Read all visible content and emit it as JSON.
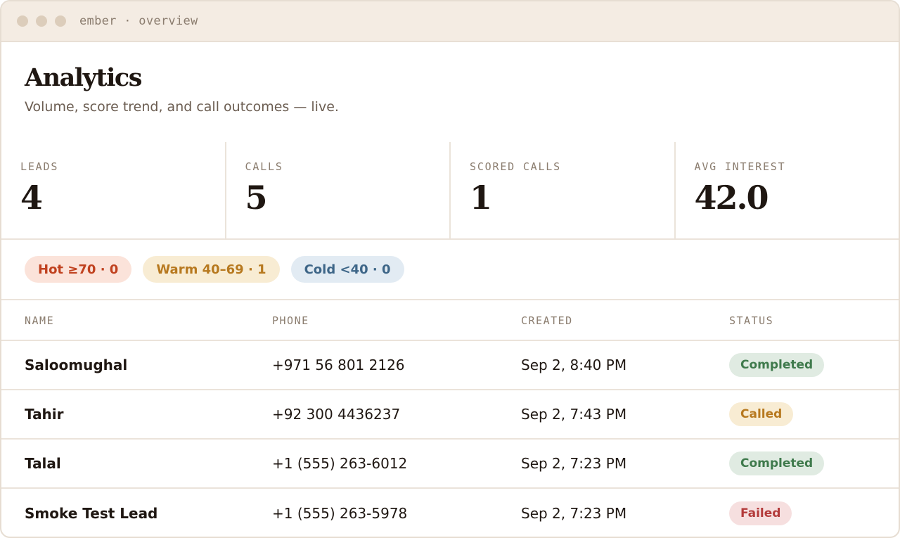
{
  "window": {
    "title": "ember · overview"
  },
  "header": {
    "title": "Analytics",
    "subtitle": "Volume, score trend, and call outcomes — live."
  },
  "stats": [
    {
      "label": "LEADS",
      "value": "4"
    },
    {
      "label": "CALLS",
      "value": "5"
    },
    {
      "label": "SCORED CALLS",
      "value": "1"
    },
    {
      "label": "AVG INTEREST",
      "value": "42.0"
    }
  ],
  "pills": [
    {
      "label": "Hot ≥70 · 0",
      "color": "#c0411f"
    },
    {
      "label": "Warm 40–69 · 1",
      "color": "#b7791f"
    },
    {
      "label": "Cold <40 · 0",
      "color": "#3e6688"
    }
  ],
  "table": {
    "columns": [
      "NAME",
      "PHONE",
      "CREATED",
      "STATUS"
    ],
    "rows": [
      {
        "name": "Saloomughal",
        "phone": "+971 56 801 2126",
        "created": "Sep 2, 8:40 PM",
        "status": "Completed"
      },
      {
        "name": "Tahir",
        "phone": "+92 300 4436237",
        "created": "Sep 2, 7:43 PM",
        "status": "Called"
      },
      {
        "name": "Talal",
        "phone": "+1 (555) 263-6012",
        "created": "Sep 2, 7:23 PM",
        "status": "Completed"
      },
      {
        "name": "Smoke Test Lead",
        "phone": "+1 (555) 263-5978",
        "created": "Sep 2, 7:23 PM",
        "status": "Failed"
      }
    ]
  },
  "colors": {
    "completed": "#3f7a4c",
    "called": "#b7791f",
    "failed": "#b33a3a"
  }
}
